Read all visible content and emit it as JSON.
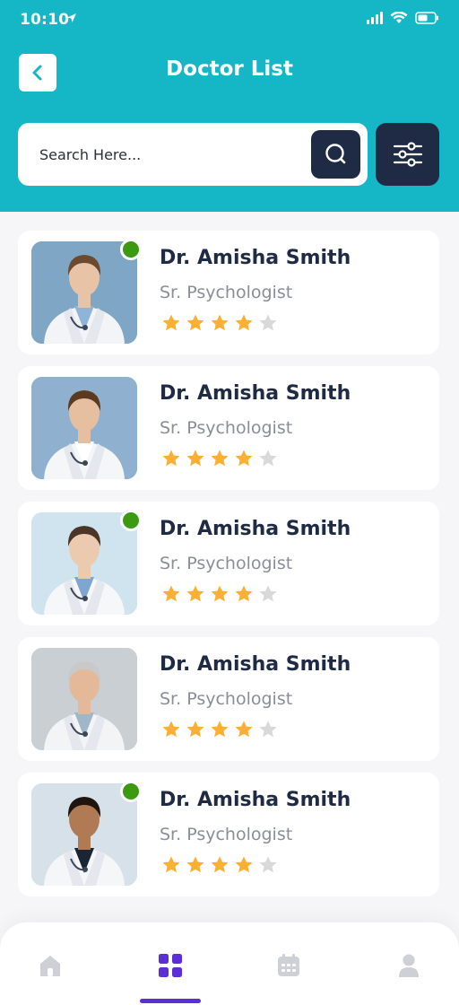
{
  "status": {
    "time": "10:10"
  },
  "header": {
    "title": "Doctor List"
  },
  "search": {
    "placeholder": "Search Here..."
  },
  "doctors": [
    {
      "name": "Dr. Amisha Smith",
      "role": "Sr. Psychologist",
      "rating": 4,
      "online": true,
      "skin": "#e9c3a6",
      "hair": "#6b4a30",
      "bg": "#7fa7c5",
      "coat": "#f2f4f7",
      "shirt": "#8fb4d8"
    },
    {
      "name": "Dr. Amisha Smith",
      "role": "Sr. Psychologist",
      "rating": 4,
      "online": false,
      "skin": "#e6bea0",
      "hair": "#5a3b22",
      "bg": "#8fb1cf",
      "coat": "#f4f6f8",
      "shirt": "#ffffff"
    },
    {
      "name": "Dr. Amisha Smith",
      "role": "Sr. Psychologist",
      "rating": 4,
      "online": true,
      "skin": "#eccab0",
      "hair": "#4a3628",
      "bg": "#cfe4ef",
      "coat": "#f5f7f9",
      "shirt": "#7ea6d0"
    },
    {
      "name": "Dr. Amisha Smith",
      "role": "Sr. Psychologist",
      "rating": 4,
      "online": false,
      "skin": "#e3b99a",
      "hair": "#c9c9c9",
      "bg": "#c9cfd3",
      "coat": "#f3f4f5",
      "shirt": "#9fb7c9"
    },
    {
      "name": "Dr. Amisha Smith",
      "role": "Sr. Psychologist",
      "rating": 4,
      "online": true,
      "skin": "#b07a55",
      "hair": "#1e1510",
      "bg": "#d6e1ea",
      "coat": "#f4f6f8",
      "shirt": "#1c2535"
    }
  ],
  "nav": {
    "active": "grid"
  },
  "colors": {
    "accent": "#15b7c6",
    "dark": "#1f2a44",
    "star": "#fbb033",
    "star_empty": "#d9d9d9",
    "online": "#3c9a11",
    "active_nav": "#5b2ed6"
  }
}
